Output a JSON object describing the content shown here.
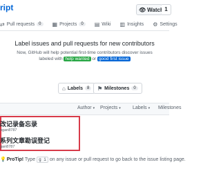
{
  "header": {
    "repo_title_fragment": "ript",
    "watch_label": "Watch",
    "watch_count": "1"
  },
  "tabs": [
    {
      "label": "Pull requests",
      "count": "0"
    },
    {
      "label": "Projects",
      "count": "0"
    },
    {
      "label": "Wiki"
    },
    {
      "label": "Insights"
    },
    {
      "label": "Settings"
    }
  ],
  "empty_state": {
    "headline": "Label issues and pull requests for new contributors",
    "line1": "Now, GitHub will help potential first-time contributors discover issues",
    "line2_prefix": "labeled with",
    "label_help_wanted": "help wanted",
    "line2_or": "or",
    "label_good_first_issue": "good first issue"
  },
  "filters": {
    "labels_label": "Labels",
    "labels_count": "8",
    "milestones_label": "Milestones",
    "milestones_count": "0"
  },
  "list_header": {
    "author": "Author",
    "projects": "Projects",
    "labels": "Labels",
    "milestones": "Milestones"
  },
  "issues": [
    {
      "title": "改记录备忘录",
      "meta": "ngan8787"
    },
    {
      "title": "系列文章勘误登记",
      "meta": "gan8787"
    }
  ],
  "protip": {
    "label": "ProTip!",
    "text_before": "Type",
    "key": "g i",
    "text_after": "on any issue or pull request to go back to the issue listing page."
  }
}
